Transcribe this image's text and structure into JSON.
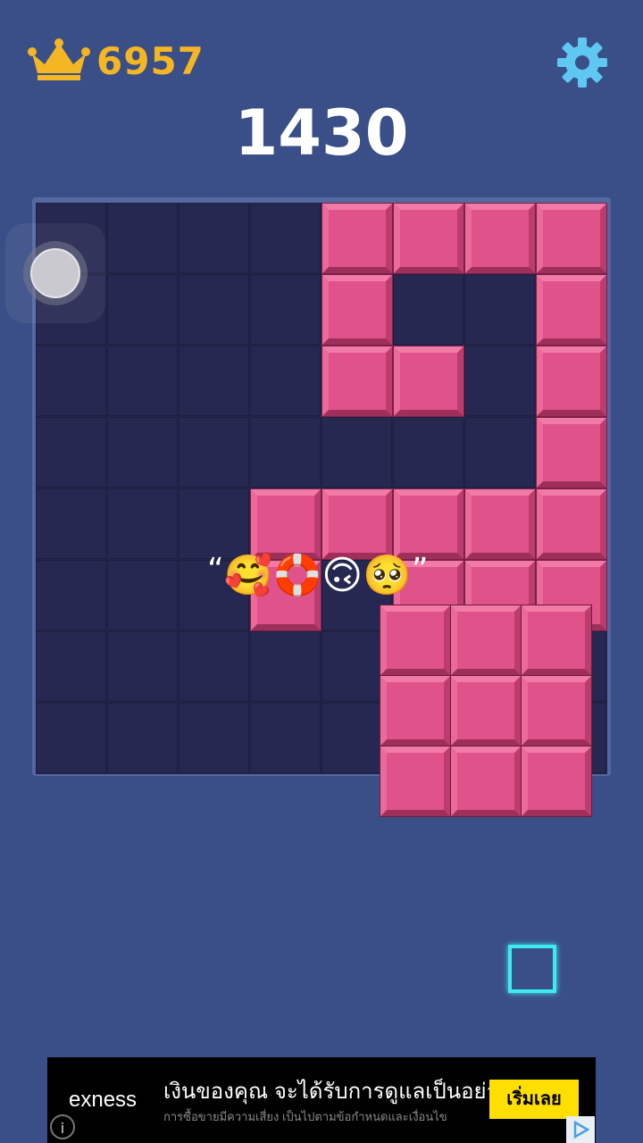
{
  "header": {
    "best_score": "6957",
    "best_icon": "crown-icon",
    "settings_icon": "gear-icon"
  },
  "score": "1430",
  "board": {
    "size": 8,
    "block_color": "#e0528a",
    "filled_cells": [
      [
        0,
        4
      ],
      [
        0,
        5
      ],
      [
        0,
        6
      ],
      [
        0,
        7
      ],
      [
        1,
        4
      ],
      [
        1,
        7
      ],
      [
        2,
        4
      ],
      [
        2,
        5
      ],
      [
        2,
        7
      ],
      [
        3,
        7
      ],
      [
        4,
        3
      ],
      [
        4,
        4
      ],
      [
        4,
        5
      ],
      [
        4,
        6
      ],
      [
        4,
        7
      ],
      [
        5,
        3
      ],
      [
        5,
        5
      ],
      [
        5,
        6
      ],
      [
        5,
        7
      ]
    ]
  },
  "dragged_piece": {
    "shape": "3x3 square",
    "color": "#e0528a"
  },
  "caption": {
    "open_quote": "“",
    "emojis": "🥰🛟🙃🥺",
    "close_quote": "”"
  },
  "tray": {
    "piece_shape": "1x1 square",
    "piece_color": "#3ee9ef"
  },
  "ad": {
    "brand": "exness",
    "headline": "เงินของคุณ จะได้รับการดูแลเป็นอย่างดี",
    "subtext": "การซื้อขายมีความเสี่ยง เป็นไปตามข้อกำหนดและเงื่อนไข",
    "cta": "เริ่มเลย",
    "info": "i"
  }
}
